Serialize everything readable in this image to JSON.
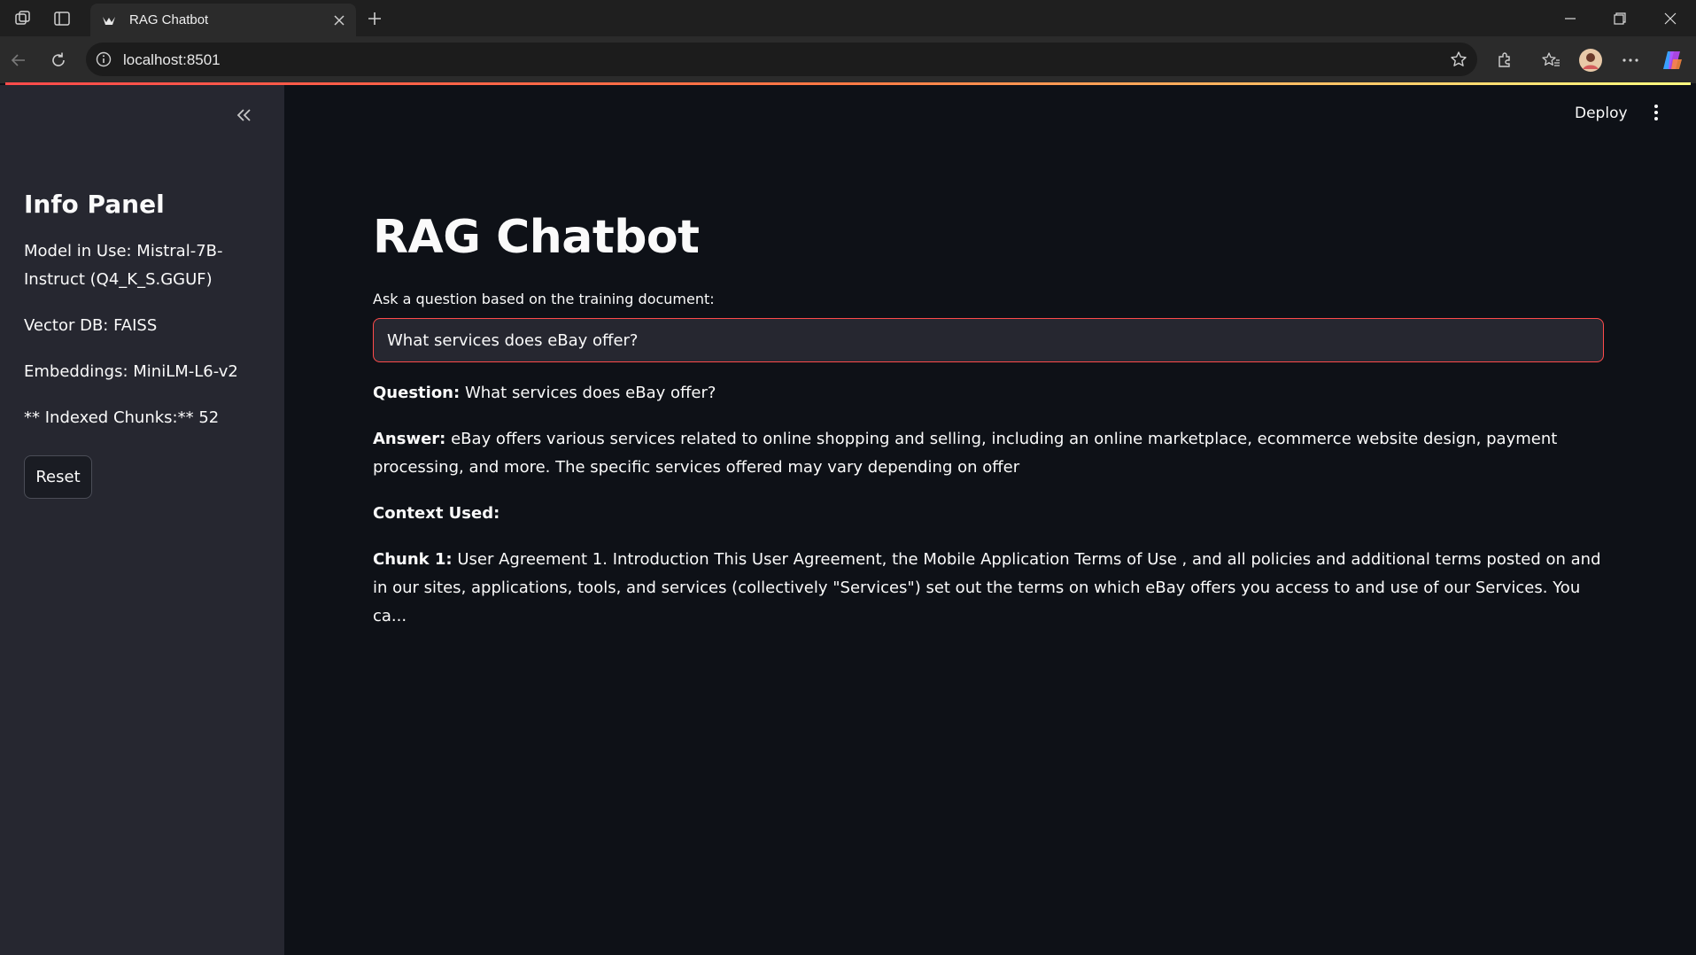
{
  "browser": {
    "tab_title": "RAG Chatbot",
    "url": "localhost:8501"
  },
  "sidebar": {
    "title": "Info Panel",
    "model": "Model in Use: Mistral-7B-Instruct (Q4_K_S.GGUF)",
    "vector_db": "Vector DB: FAISS",
    "embeddings": "Embeddings: MiniLM-L6-v2",
    "indexed_chunks": "** Indexed Chunks:** 52",
    "reset_label": "Reset"
  },
  "header": {
    "deploy_label": "Deploy"
  },
  "main": {
    "title": "RAG Chatbot",
    "input_label": "Ask a question based on the training document:",
    "input_value": "What services does eBay offer?",
    "question_label": "Question:",
    "question_text": "What services does eBay offer?",
    "answer_label": "Answer:",
    "answer_text": "eBay offers various services related to online shopping and selling, including an online marketplace, ecommerce website design, payment processing, and more. The specific services offered may vary depending on offer",
    "context_label": "Context Used:",
    "chunk_label": "Chunk 1:",
    "chunk_text": "User Agreement 1. Introduction This User Agreement, the Mobile Application Terms of Use , and all policies and additional terms posted on and in our sites, applications, tools, and services (collectively \"Services\") set out the terms on which eBay offers you access to and use of our Services. You ca..."
  },
  "colors": {
    "accent": "#ff4b4b",
    "sidebar_bg": "#262730",
    "main_bg": "#0e1117"
  }
}
